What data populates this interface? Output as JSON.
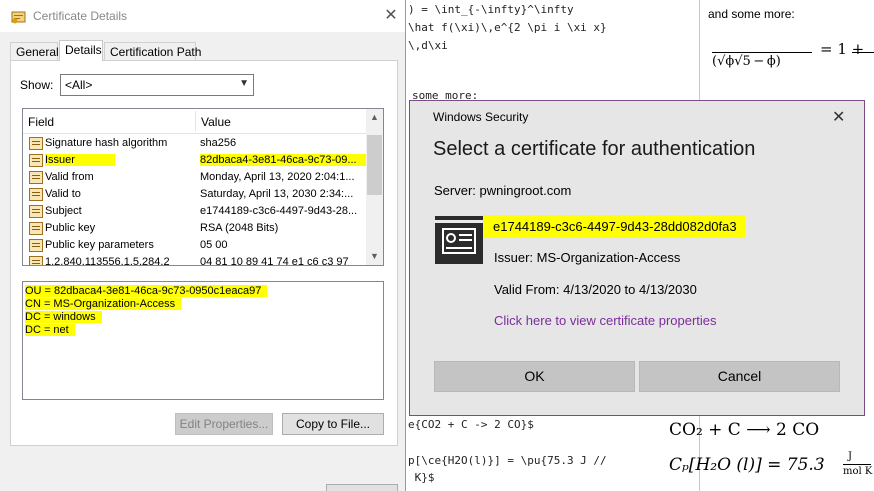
{
  "background_editor": {
    "lines": [
      ") = \\int_{-\\infty}^\\infty",
      "\\hat f(\\xi)\\,e^{2 \\pi i \\xi x}",
      "\\,d\\xi",
      "some more:",
      "e{CO2 + C -> 2 CO}$",
      "p[\\ce{H2O(l)}] = \\pu{75.3 J //",
      " K}$"
    ]
  },
  "background_preview": {
    "heading": "and some more:",
    "formula_rhs": "= 1 +",
    "chem_eq": "CO₂ + C ⟶ 2 CO",
    "heat_eq_lhs": "Cₚ[H₂O (l)] = 75.3",
    "heat_unit_num": "J",
    "heat_unit_den": "mol K"
  },
  "cert_dialog": {
    "title": "Certificate Details",
    "tabs": [
      "General",
      "Details",
      "Certification Path"
    ],
    "active_tab": "Details",
    "show_label": "Show:",
    "show_value": "<All>",
    "columns": [
      "Field",
      "Value"
    ],
    "rows": [
      {
        "field": "Signature hash algorithm",
        "value": "sha256",
        "highlight": false
      },
      {
        "field": "Issuer",
        "value": "82dbaca4-3e81-46ca-9c73-09...",
        "highlight": true
      },
      {
        "field": "Valid from",
        "value": "Monday, April 13, 2020 2:04:1...",
        "highlight": false
      },
      {
        "field": "Valid to",
        "value": "Saturday, April 13, 2030 2:34:...",
        "highlight": false
      },
      {
        "field": "Subject",
        "value": "e1744189-c3c6-4497-9d43-28...",
        "highlight": false
      },
      {
        "field": "Public key",
        "value": "RSA (2048 Bits)",
        "highlight": false
      },
      {
        "field": "Public key parameters",
        "value": "05 00",
        "highlight": false
      },
      {
        "field": "1.2.840.113556.1.5.284.2",
        "value": "04 81 10 89 41 74 e1 c6 c3 97",
        "highlight": false
      }
    ],
    "detail_lines": [
      "OU = 82dbaca4-3e81-46ca-9c73-0950c1eaca97",
      "CN = MS-Organization-Access",
      "DC = windows",
      "DC = net"
    ],
    "edit_properties_label": "Edit Properties...",
    "copy_to_file_label": "Copy to File..."
  },
  "security_dialog": {
    "window_title": "Windows Security",
    "heading": "Select a certificate for authentication",
    "server": "Server: pwningroot.com",
    "certificate_name": "e1744189-c3c6-4497-9d43-28dd082d0fa3",
    "issuer": "Issuer: MS-Organization-Access",
    "valid": "Valid From: 4/13/2020 to 4/13/2030",
    "properties_link": "Click here to view certificate properties",
    "ok_label": "OK",
    "cancel_label": "Cancel",
    "link_color": "#7b2d9b",
    "highlight_color": "#ffff00"
  }
}
